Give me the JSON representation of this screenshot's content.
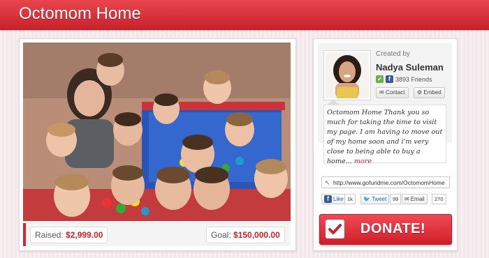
{
  "header": {
    "title": "Octomom Home"
  },
  "campaign": {
    "raised_label": "Raised:",
    "raised_amount": "$2,999.00",
    "goal_label": "Goal:",
    "goal_amount": "$150,000.00"
  },
  "creator": {
    "created_by_label": "Created by",
    "name": "Nadya Suleman",
    "friends": "3893 Friends",
    "contact_label": "Contact",
    "embed_label": "Embed"
  },
  "description": {
    "text": "Octomom Home  Thank you so much for taking the time to visit my page. I am having to move out of my home soon and i'm very close to being able to buy a home...",
    "more_label": "more"
  },
  "share": {
    "url": "http://www.gofundme.com/OctomomHome",
    "fb_like_label": "Like",
    "fb_like_count": "1k",
    "tweet_label": "Tweet",
    "tweet_count": "99",
    "email_label": "Email",
    "email_count": "270"
  },
  "donate": {
    "label": "DONATE!"
  },
  "colors": {
    "brand_red": "#d8262f",
    "amount_red": "#d0202a"
  }
}
